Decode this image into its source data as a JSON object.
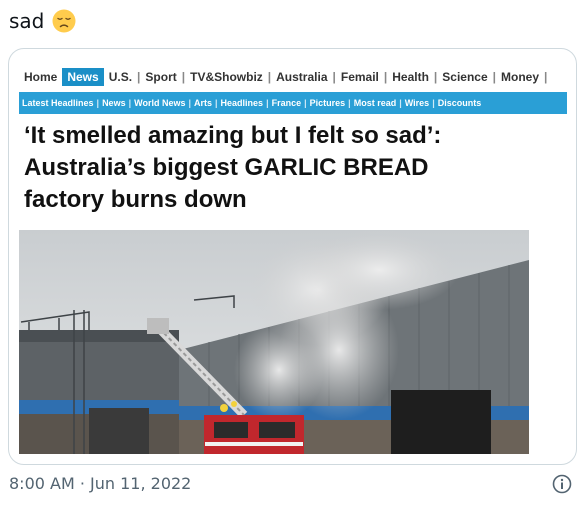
{
  "tweet": {
    "text": "sad",
    "emoji_icon": "disappointed-face-emoji",
    "timestamp": "8:00 AM · Jun 11, 2022",
    "info_icon": "info-icon"
  },
  "article": {
    "nav_primary": [
      "Home",
      "News",
      "U.S.",
      "Sport",
      "TV&Showbiz",
      "Australia",
      "Femail",
      "Health",
      "Science",
      "Money"
    ],
    "nav_primary_active": "News",
    "nav_secondary": [
      "Latest Headlines",
      "News",
      "World News",
      "Arts",
      "Headlines",
      "France",
      "Pictures",
      "Most read",
      "Wires",
      "Discounts"
    ],
    "headline_line1": "‘It smelled amazing but I felt so sad’:",
    "headline_line2": "Australia’s biggest GARLIC BREAD",
    "headline_line3": "factory burns down",
    "nav_bar_color": "#2a9fd6"
  }
}
